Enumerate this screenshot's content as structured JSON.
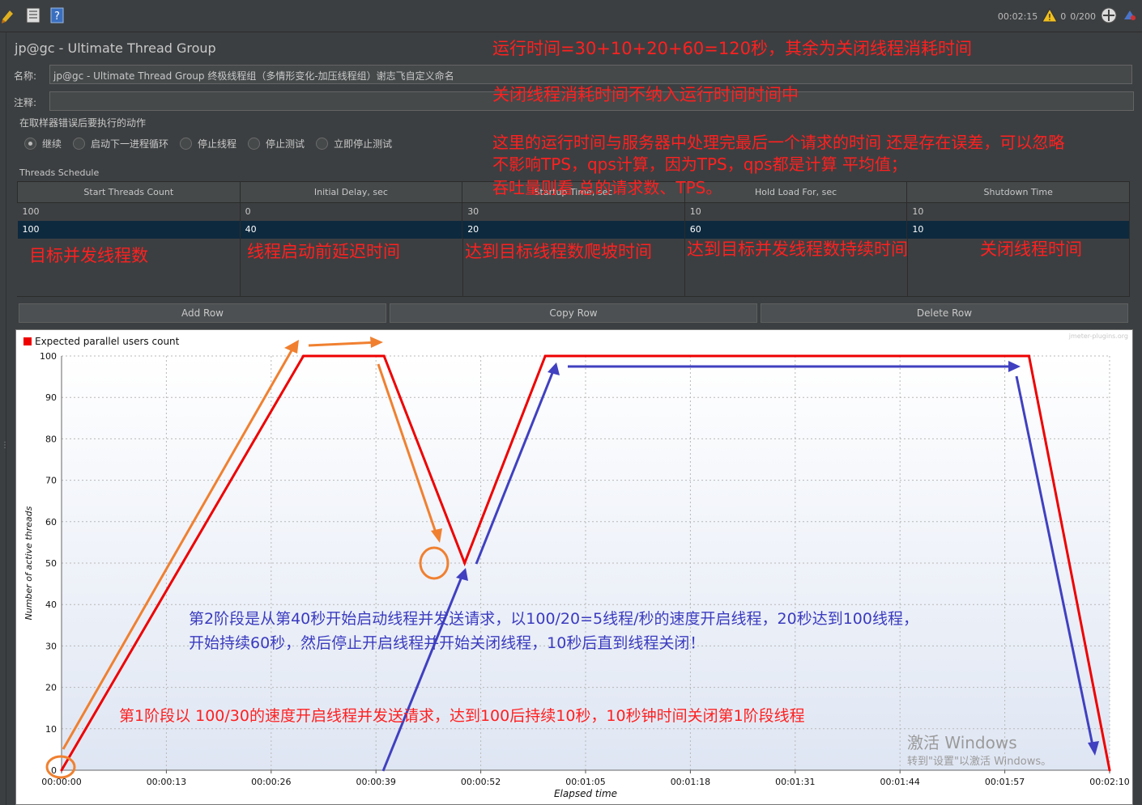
{
  "toolbar": {
    "timer": "00:02:15",
    "warnings": "0",
    "threads": "0/200"
  },
  "panel": {
    "title": "jp@gc - Ultimate Thread Group",
    "name_label": "名称:",
    "name_value": "jp@gc - Ultimate Thread Group 终极线程组（多情形变化-加压线程组）谢志飞自定义命名",
    "comment_label": "注释:",
    "comment_value": "",
    "error_action_label": "在取样器错误后要执行的动作",
    "error_actions": [
      "继续",
      "启动下一进程循环",
      "停止线程",
      "停止测试",
      "立即停止测试"
    ]
  },
  "schedule": {
    "title": "Threads Schedule",
    "headers": [
      "Start Threads Count",
      "Initial Delay, sec",
      "Startup Time, sec",
      "Hold Load For, sec",
      "Shutdown Time"
    ],
    "rows": [
      [
        "100",
        "0",
        "30",
        "10",
        "10"
      ],
      [
        "100",
        "40",
        "20",
        "60",
        "10"
      ]
    ],
    "selected_row": 1
  },
  "buttons": {
    "add_row": "Add Row",
    "copy_row": "Copy Row",
    "delete_row": "Delete Row"
  },
  "chart_data": {
    "type": "line",
    "title": "",
    "watermark": "jmeter-plugins.org",
    "legend": "Expected parallel users count",
    "legend_position": "top-left",
    "xlabel": "Elapsed time",
    "ylabel": "Number of active threads",
    "x_ticks": [
      "00:00:00",
      "00:00:13",
      "00:00:26",
      "00:00:39",
      "00:00:52",
      "00:01:05",
      "00:01:18",
      "00:01:31",
      "00:01:44",
      "00:01:57",
      "00:02:10"
    ],
    "y_ticks": [
      0,
      10,
      20,
      30,
      40,
      50,
      60,
      70,
      80,
      90,
      100
    ],
    "xlim": [
      0,
      130
    ],
    "ylim": [
      0,
      100
    ],
    "grid": true,
    "color": "#ee0000",
    "series": [
      {
        "name": "Expected parallel users count",
        "x": [
          0,
          30,
          40,
          50,
          60,
          120,
          130
        ],
        "y": [
          0,
          100,
          100,
          50,
          100,
          100,
          0
        ]
      }
    ]
  },
  "annotations": {
    "runtime": "运行时间=30+10+20+60=120秒，其余为关闭线程消耗时间",
    "shutdown_note": "关闭线程消耗时间不纳入运行时间时间中",
    "note_line1": "这里的运行时间与服务器中处理完最后一个请求的时间 还是存在误差，可以忽略",
    "note_line2": "不影响TPS，qps计算，因为TPS，qps都是计算 平均值；",
    "note_line3": "吞吐量则看 总的请求数、TPS。",
    "col1": "目标并发线程数",
    "col2": "线程启动前延迟时间",
    "col3": "达到目标线程数爬坡时间",
    "col4": "达到目标并发线程数持续时间",
    "col5": "关闭线程时间",
    "stage2_line1": "第2阶段是从第40秒开始启动线程并发送请求，以100/20=5线程/秒的速度开启线程，20秒达到100线程，",
    "stage2_line2": "开始持续60秒，然后停止开启线程并开始关闭线程，10秒后直到线程关闭！",
    "stage1": "第1阶段以 100/30的速度开启线程并发送请求，达到100后持续10秒，10秒钟时间关闭第1阶段线程",
    "win_activate": "激活 Windows",
    "win_activate_sub": "转到\"设置\"以激活 Windows。"
  }
}
